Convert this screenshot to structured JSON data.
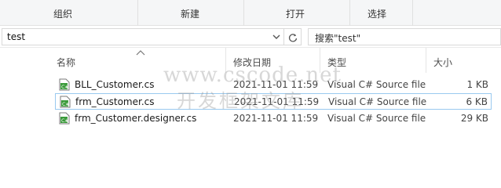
{
  "ribbon": {
    "groups": [
      "组织",
      "新建",
      "打开",
      "选择"
    ]
  },
  "address": {
    "path": "test",
    "dropdown_icon": "chevron-down-icon",
    "refresh_icon": "refresh-icon"
  },
  "search": {
    "placeholder": "搜索\"test\""
  },
  "columns": {
    "name": "名称",
    "date": "修改日期",
    "type": "类型",
    "size": "大小"
  },
  "files": [
    {
      "name": "BLL_Customer.cs",
      "date": "2021-11-01 11:59",
      "type": "Visual C# Source file",
      "size": "1 KB"
    },
    {
      "name": "frm_Customer.cs",
      "date": "2021-11-01 11:59",
      "type": "Visual C# Source file",
      "size": "6 KB"
    },
    {
      "name": "frm_Customer.designer.cs",
      "date": "2021-11-01 11:59",
      "type": "Visual C# Source file",
      "size": "29 KB"
    }
  ],
  "watermark": {
    "line1": "www.cscode.net",
    "line2": "开发框架文库"
  },
  "colors": {
    "selection_border": "#99c9ef",
    "icon_green": "#3a9a3a"
  }
}
